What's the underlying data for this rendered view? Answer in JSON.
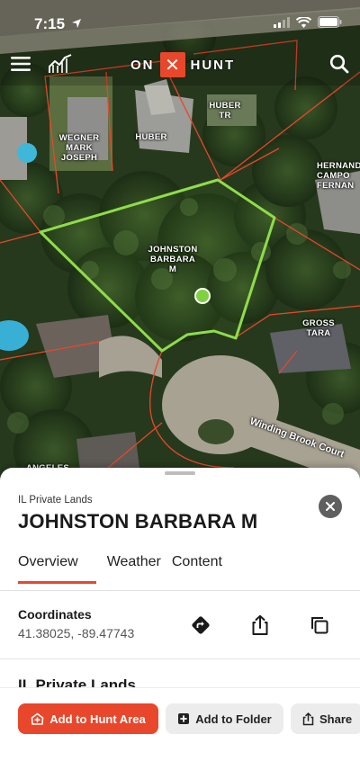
{
  "status_bar": {
    "time": "7:15"
  },
  "app_bar": {
    "brand_left": "ON",
    "brand_mark": "✕",
    "brand_right": "HUNT"
  },
  "map": {
    "parcel_labels": [
      "WEGNER\nMARK\nJOSEPH",
      "HUBER",
      "HUBER\nTR",
      "HERNAND\nCAMPO\nFERNAN",
      "JOHNSTON\nBARBARA\nM",
      "GROSS\nTARA",
      "ANGELES"
    ],
    "road_label": "Winding Brook Court"
  },
  "sheet": {
    "subtitle": "IL Private Lands",
    "title": "JOHNSTON BARBARA M",
    "tabs": [
      {
        "label": "Overview",
        "active": true
      },
      {
        "label": "Weather",
        "active": false
      },
      {
        "label": "Content",
        "active": false
      }
    ],
    "coordinates_label": "Coordinates",
    "coordinates_value": "41.38025, -89.47743",
    "section_heading": "IL Private Lands"
  },
  "actions": {
    "add_hunt_area": "Add to Hunt Area",
    "add_folder": "Add to Folder",
    "share": "Share"
  },
  "colors": {
    "accent": "#e8472b",
    "parcel_highlight": "#8fdc4a",
    "boundary": "#e8472b"
  }
}
